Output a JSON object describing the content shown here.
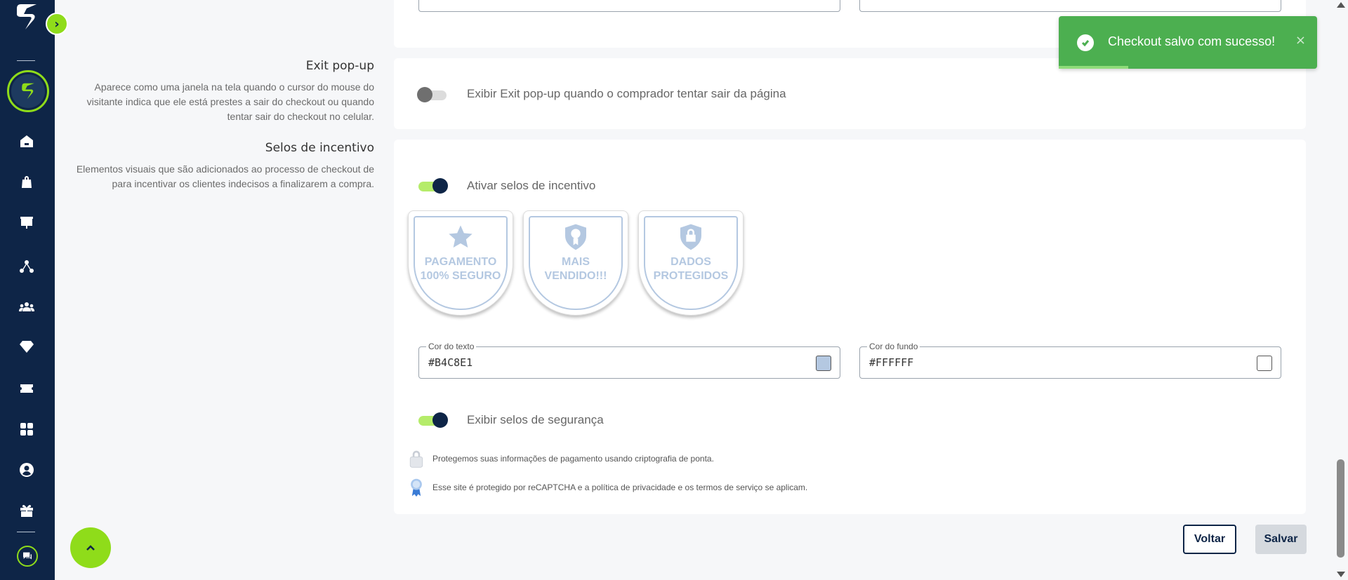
{
  "toast": {
    "message": "Checkout salvo com sucesso!",
    "close": "×",
    "progress": 0.27
  },
  "exit_popup": {
    "title": "Exit pop-up",
    "description": "Aparece como uma janela na tela quando o cursor do mouse do visitante indica que ele está prestes a sair do checkout ou quando tentar sair do checkout no celular.",
    "toggle_label": "Exibir Exit pop-up quando o comprador tentar sair da página",
    "enabled": false
  },
  "incentive": {
    "title": "Selos de incentivo",
    "description": "Elementos visuais que são adicionados ao processo de checkout de para incentivar os clientes indecisos a finalizarem a compra.",
    "toggle_label": "Ativar selos de incentivo",
    "enabled": true,
    "badges": [
      {
        "line1": "PAGAMENTO",
        "line2": "100% SEGURO",
        "icon": "star-icon"
      },
      {
        "line1": "MAIS",
        "line2": "VENDIDO!!!",
        "icon": "award-shield-icon"
      },
      {
        "line1": "DADOS",
        "line2": "PROTEGIDOS",
        "icon": "lock-shield-icon"
      }
    ],
    "text_color": {
      "label": "Cor do texto",
      "value": "#B4C8E1"
    },
    "bg_color": {
      "label": "Cor do fundo",
      "value": "#FFFFFF"
    }
  },
  "security": {
    "toggle_label": "Exibir selos de segurança",
    "enabled": true,
    "lines": [
      {
        "icon": "padlock-icon",
        "text": "Protegemos suas informações de pagamento usando criptografia de ponta."
      },
      {
        "icon": "ribbon-icon",
        "text": "Esse site é protegido por reCAPTCHA e a política de privacidade e os termos de serviço se aplicam."
      }
    ]
  },
  "actions": {
    "back_label": "Voltar",
    "save_label": "Salvar"
  },
  "colors": {
    "sidebar": "#0e2547",
    "accent": "#8fdc1a",
    "toast": "#4caf50",
    "badge": "#b4c8e1"
  }
}
